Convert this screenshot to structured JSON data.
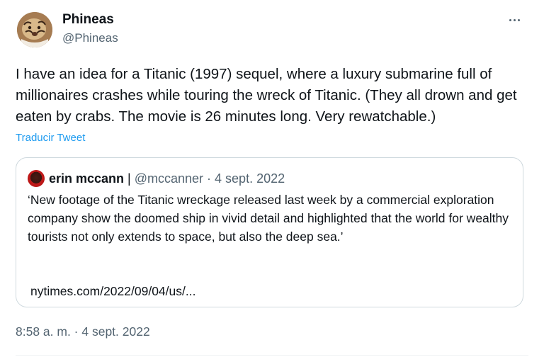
{
  "tweet": {
    "author": {
      "name": "Phineas",
      "handle": "@Phineas"
    },
    "text": "I have an idea for a Titanic (1997) sequel, where a luxury submarine full of millionaires crashes while touring the wreck of Titanic. (They all drown and get eaten by crabs. The movie is 26 minutes long. Very rewatchable.)",
    "translate_label": "Traducir Tweet",
    "timestamp": "8:58 a. m. · 4 sept. 2022",
    "more_icon": "ellipsis-icon"
  },
  "quote": {
    "name": "erin mccann",
    "separator": " | ",
    "meta": "@mccanner · 4 sept. 2022",
    "text": "‘New footage of the Titanic wreckage released last week by a commercial exploration company show the doomed ship in vivid detail and highlighted that the world for wealthy tourists not only extends to space, but also the deep sea.’",
    "link": "nytimes.com/2022/09/04/us/..."
  },
  "colors": {
    "text": "#0f1419",
    "secondary": "#536471",
    "link": "#1d9bf0",
    "border": "#cfd9de"
  }
}
